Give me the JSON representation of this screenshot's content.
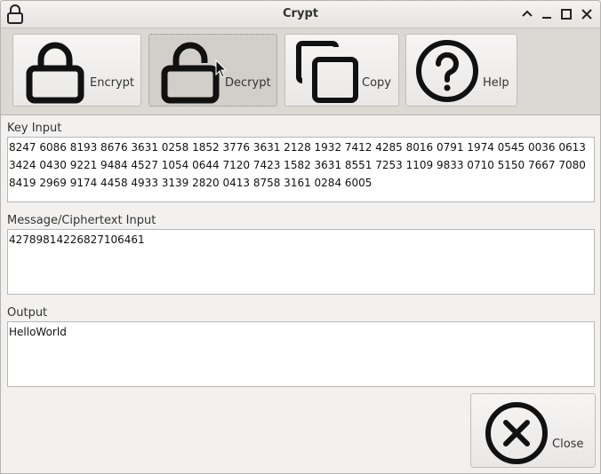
{
  "window": {
    "title": "Crypt"
  },
  "titlebar_icons": {
    "app": "lock-icon",
    "minimize": "chevron-up-icon",
    "restore": "minimize-icon",
    "maximize": "maximize-icon",
    "close": "close-icon"
  },
  "toolbar": {
    "encrypt_label": "Encrypt",
    "decrypt_label": "Decrypt",
    "copy_label": "Copy",
    "help_label": "Help",
    "icons": [
      "lock-icon",
      "unlock-icon",
      "copy-icon",
      "help-icon"
    ]
  },
  "key": {
    "label": "Key Input",
    "value": "8247 6086 8193 8676 3631 0258 1852 3776 3631 2128 1932 7412 4285 8016 0791 1974 0545 0036 0613 3424 0430 9221 9484 4527 1054 0644 7120 7423 1582 3631 8551 7253 1109 9833 0710 5150 7667 7080 8419 2969 9174 4458 4933 3139 2820 0413 8758 3161 0284 6005"
  },
  "message": {
    "label": "Message/Ciphertext Input",
    "value": "42789814226827106461"
  },
  "output": {
    "label": "Output",
    "value": "HelloWorld"
  },
  "close": {
    "label": "Close",
    "icon": "close-circle-icon"
  }
}
